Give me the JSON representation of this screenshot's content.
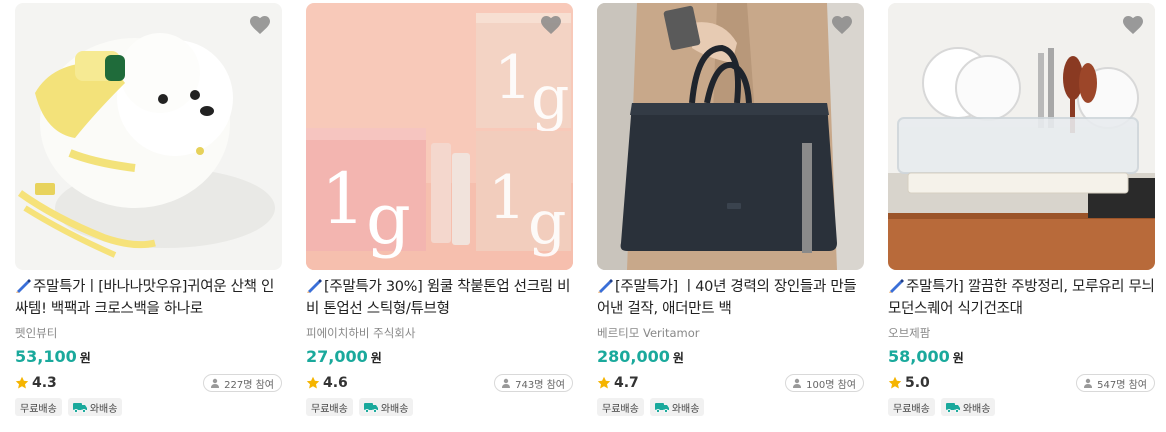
{
  "products": [
    {
      "title": "주말특가ㅣ[바나나맛우유]귀여운 산책 인싸템! 백팩과 크로스백을 하나로",
      "brand": "펫인뷰티",
      "price": "53,100",
      "currency": "원",
      "rating": "4.3",
      "participants": "227명 참여",
      "tags": [
        "무료배송",
        "와배송"
      ]
    },
    {
      "title": "[주말특가 30%] 윔쿨 착붙톤업 선크림 비비 톤업선 스틱형/튜브형",
      "brand": "피에이치하비 주식회사",
      "price": "27,000",
      "currency": "원",
      "rating": "4.6",
      "participants": "743명 참여",
      "tags": [
        "무료배송",
        "와배송"
      ]
    },
    {
      "title": "[주말특가] ㅣ40년 경력의 장인들과 만들어낸 걸작, 애더만트 백",
      "brand": "베르티모 Veritamor",
      "price": "280,000",
      "currency": "원",
      "rating": "4.7",
      "participants": "100명 참여",
      "tags": [
        "무료배송",
        "와배송"
      ]
    },
    {
      "title": "주말특가] 깔끔한 주방정리, 모루유리 무늬 모던스퀘어 식기건조대",
      "brand": "오브제팜",
      "price": "58,000",
      "currency": "원",
      "rating": "5.0",
      "participants": "547명 참여",
      "tags": [
        "무료배송",
        "와배송"
      ]
    }
  ],
  "icons": {
    "wishlist": "heart-icon",
    "title_prefix": "pen-emoji-icon",
    "rating": "star-icon",
    "participants": "person-icon",
    "delivery": "truck-icon"
  },
  "colors": {
    "price": "#1aa99c",
    "star": "#f5b400",
    "truck": "#1aa99c",
    "heart": "#8a8a8a"
  }
}
